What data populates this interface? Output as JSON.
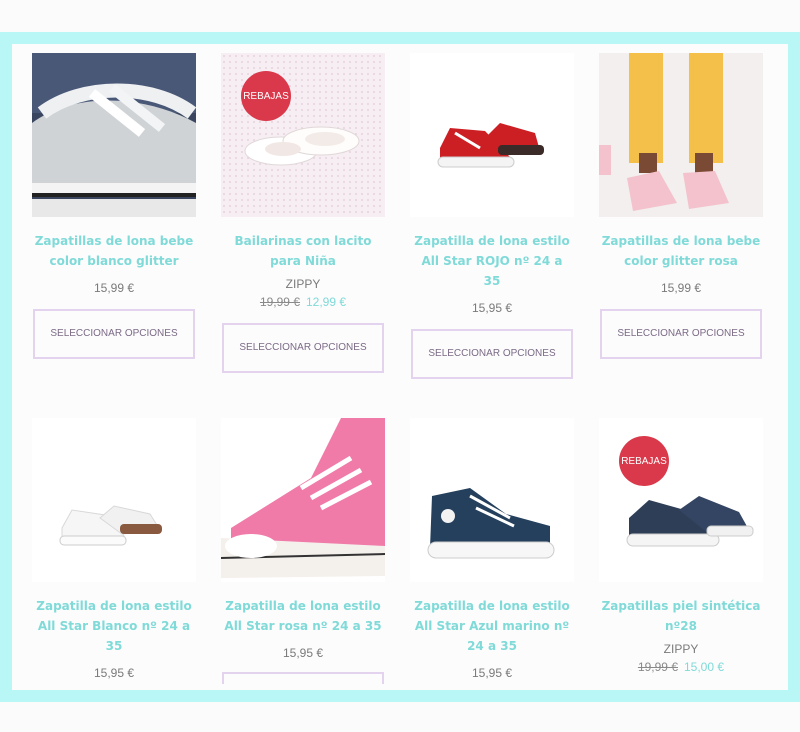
{
  "products": [
    {
      "title": "Zapatillas de lona bebe color blanco glitter",
      "brand": "",
      "price": "15,99 €",
      "old_price": "",
      "new_price": "",
      "button": "SELECCIONAR OPCIONES",
      "badge": "",
      "image": "silver-glitter-sneaker"
    },
    {
      "title": "Bailarinas con lacito para Niña",
      "brand": "ZIPPY",
      "price": "",
      "old_price": "19,99 €",
      "new_price": "12,99 €",
      "button": "SELECCIONAR OPCIONES",
      "badge": "REBAJAS",
      "image": "white-ballerina-flats"
    },
    {
      "title": "Zapatilla de lona estilo All Star ROJO nº 24 a 35",
      "brand": "",
      "price": "15,95 €",
      "old_price": "",
      "new_price": "",
      "button": "SELECCIONAR OPCIONES",
      "badge": "",
      "image": "red-canvas-sneakers"
    },
    {
      "title": "Zapatillas de lona bebe color glitter rosa",
      "brand": "",
      "price": "15,99 €",
      "old_price": "",
      "new_price": "",
      "button": "SELECCIONAR OPCIONES",
      "badge": "",
      "image": "pink-glitter-sneakers-kid"
    },
    {
      "title": "Zapatilla de lona estilo All Star Blanco nº 24 a 35",
      "brand": "",
      "price": "15,95 €",
      "old_price": "",
      "new_price": "",
      "button": "",
      "badge": "",
      "image": "white-canvas-sneakers"
    },
    {
      "title": "Zapatilla de lona estilo All Star rosa nº 24 a 35",
      "brand": "",
      "price": "15,95 €",
      "old_price": "",
      "new_price": "",
      "button": "",
      "badge": "",
      "image": "pink-hightop-sneaker"
    },
    {
      "title": "Zapatilla de lona estilo All Star Azul marino nº 24 a 35",
      "brand": "",
      "price": "15,95 €",
      "old_price": "",
      "new_price": "",
      "button": "",
      "badge": "",
      "image": "navy-hightop-sneaker"
    },
    {
      "title": "Zapatillas piel sintética nº28",
      "brand": "ZIPPY",
      "price": "",
      "old_price": "19,99 €",
      "new_price": "15,00 €",
      "button": "",
      "badge": "REBAJAS",
      "image": "navy-leather-sneakers"
    }
  ],
  "colors": {
    "accent": "#7fdad8",
    "badge": "#d9394a",
    "frame": "#b8f7f5",
    "button_border": "#e3d3ef"
  }
}
